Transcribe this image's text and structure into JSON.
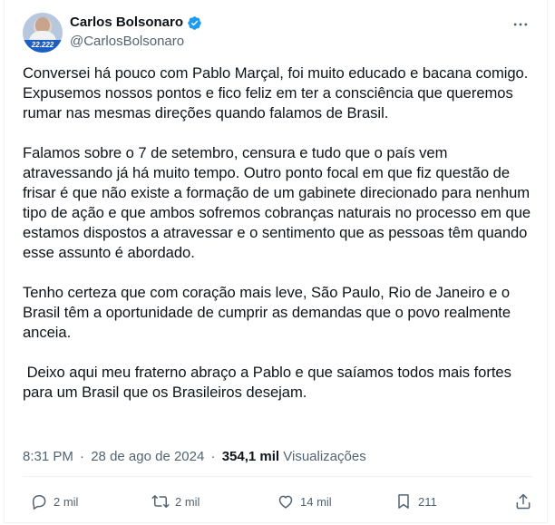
{
  "author": {
    "display_name": "Carlos Bolsonaro",
    "handle": "@CarlosBolsonaro",
    "avatar_band_text": "22.222"
  },
  "post": {
    "paragraphs": [
      "Conversei há pouco com Pablo Marçal, foi muito educado e bacana comigo. Expusemos nossos pontos e fico feliz em ter a consciência que queremos rumar nas mesmas direções quando falamos de Brasil.",
      "Falamos sobre o 7 de setembro, censura e tudo que o país vem atravessando já há muito tempo. Outro ponto focal em que fiz questão de frisar é que não existe a formação de um gabinete direcionado para nenhum tipo de ação e que ambos sofremos cobranças naturais no processo em que estamos dispostos a atravessar e o sentimento que as pessoas têm quando esse assunto é abordado.",
      "Tenho certeza que com coração mais leve, São Paulo, Rio de Janeiro e o Brasil têm a oportunidade de cumprir as demandas que o povo realmente anceia.",
      " Deixo aqui meu fraterno abraço a Pablo e que saíamos todos mais fortes para um Brasil que os Brasileiros desejam."
    ],
    "time": "8:31 PM",
    "separator": "·",
    "date": "28 de ago de 2024",
    "views_count": "354,1 mil",
    "views_label": "Visualizações"
  },
  "actions": {
    "reply_count": "2 mil",
    "repost_count": "2 mil",
    "like_count": "14 mil",
    "bookmark_count": "211"
  },
  "colors": {
    "verified": "#1d9bf0",
    "text_primary": "#0f1419",
    "text_secondary": "#536471",
    "divider": "#eff3f4"
  },
  "icons": {
    "verified": "verified-badge-icon",
    "more": "more-options-icon",
    "reply": "reply-icon",
    "repost": "repost-icon",
    "like": "heart-icon",
    "bookmark": "bookmark-icon",
    "share": "share-icon"
  }
}
